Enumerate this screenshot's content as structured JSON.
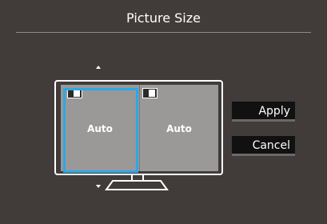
{
  "header": {
    "title": "Picture Size"
  },
  "preview": {
    "left_label": "Auto",
    "right_label": "Auto",
    "selection_color": "#2aa8e8"
  },
  "buttons": {
    "apply": "Apply",
    "cancel": "Cancel"
  }
}
